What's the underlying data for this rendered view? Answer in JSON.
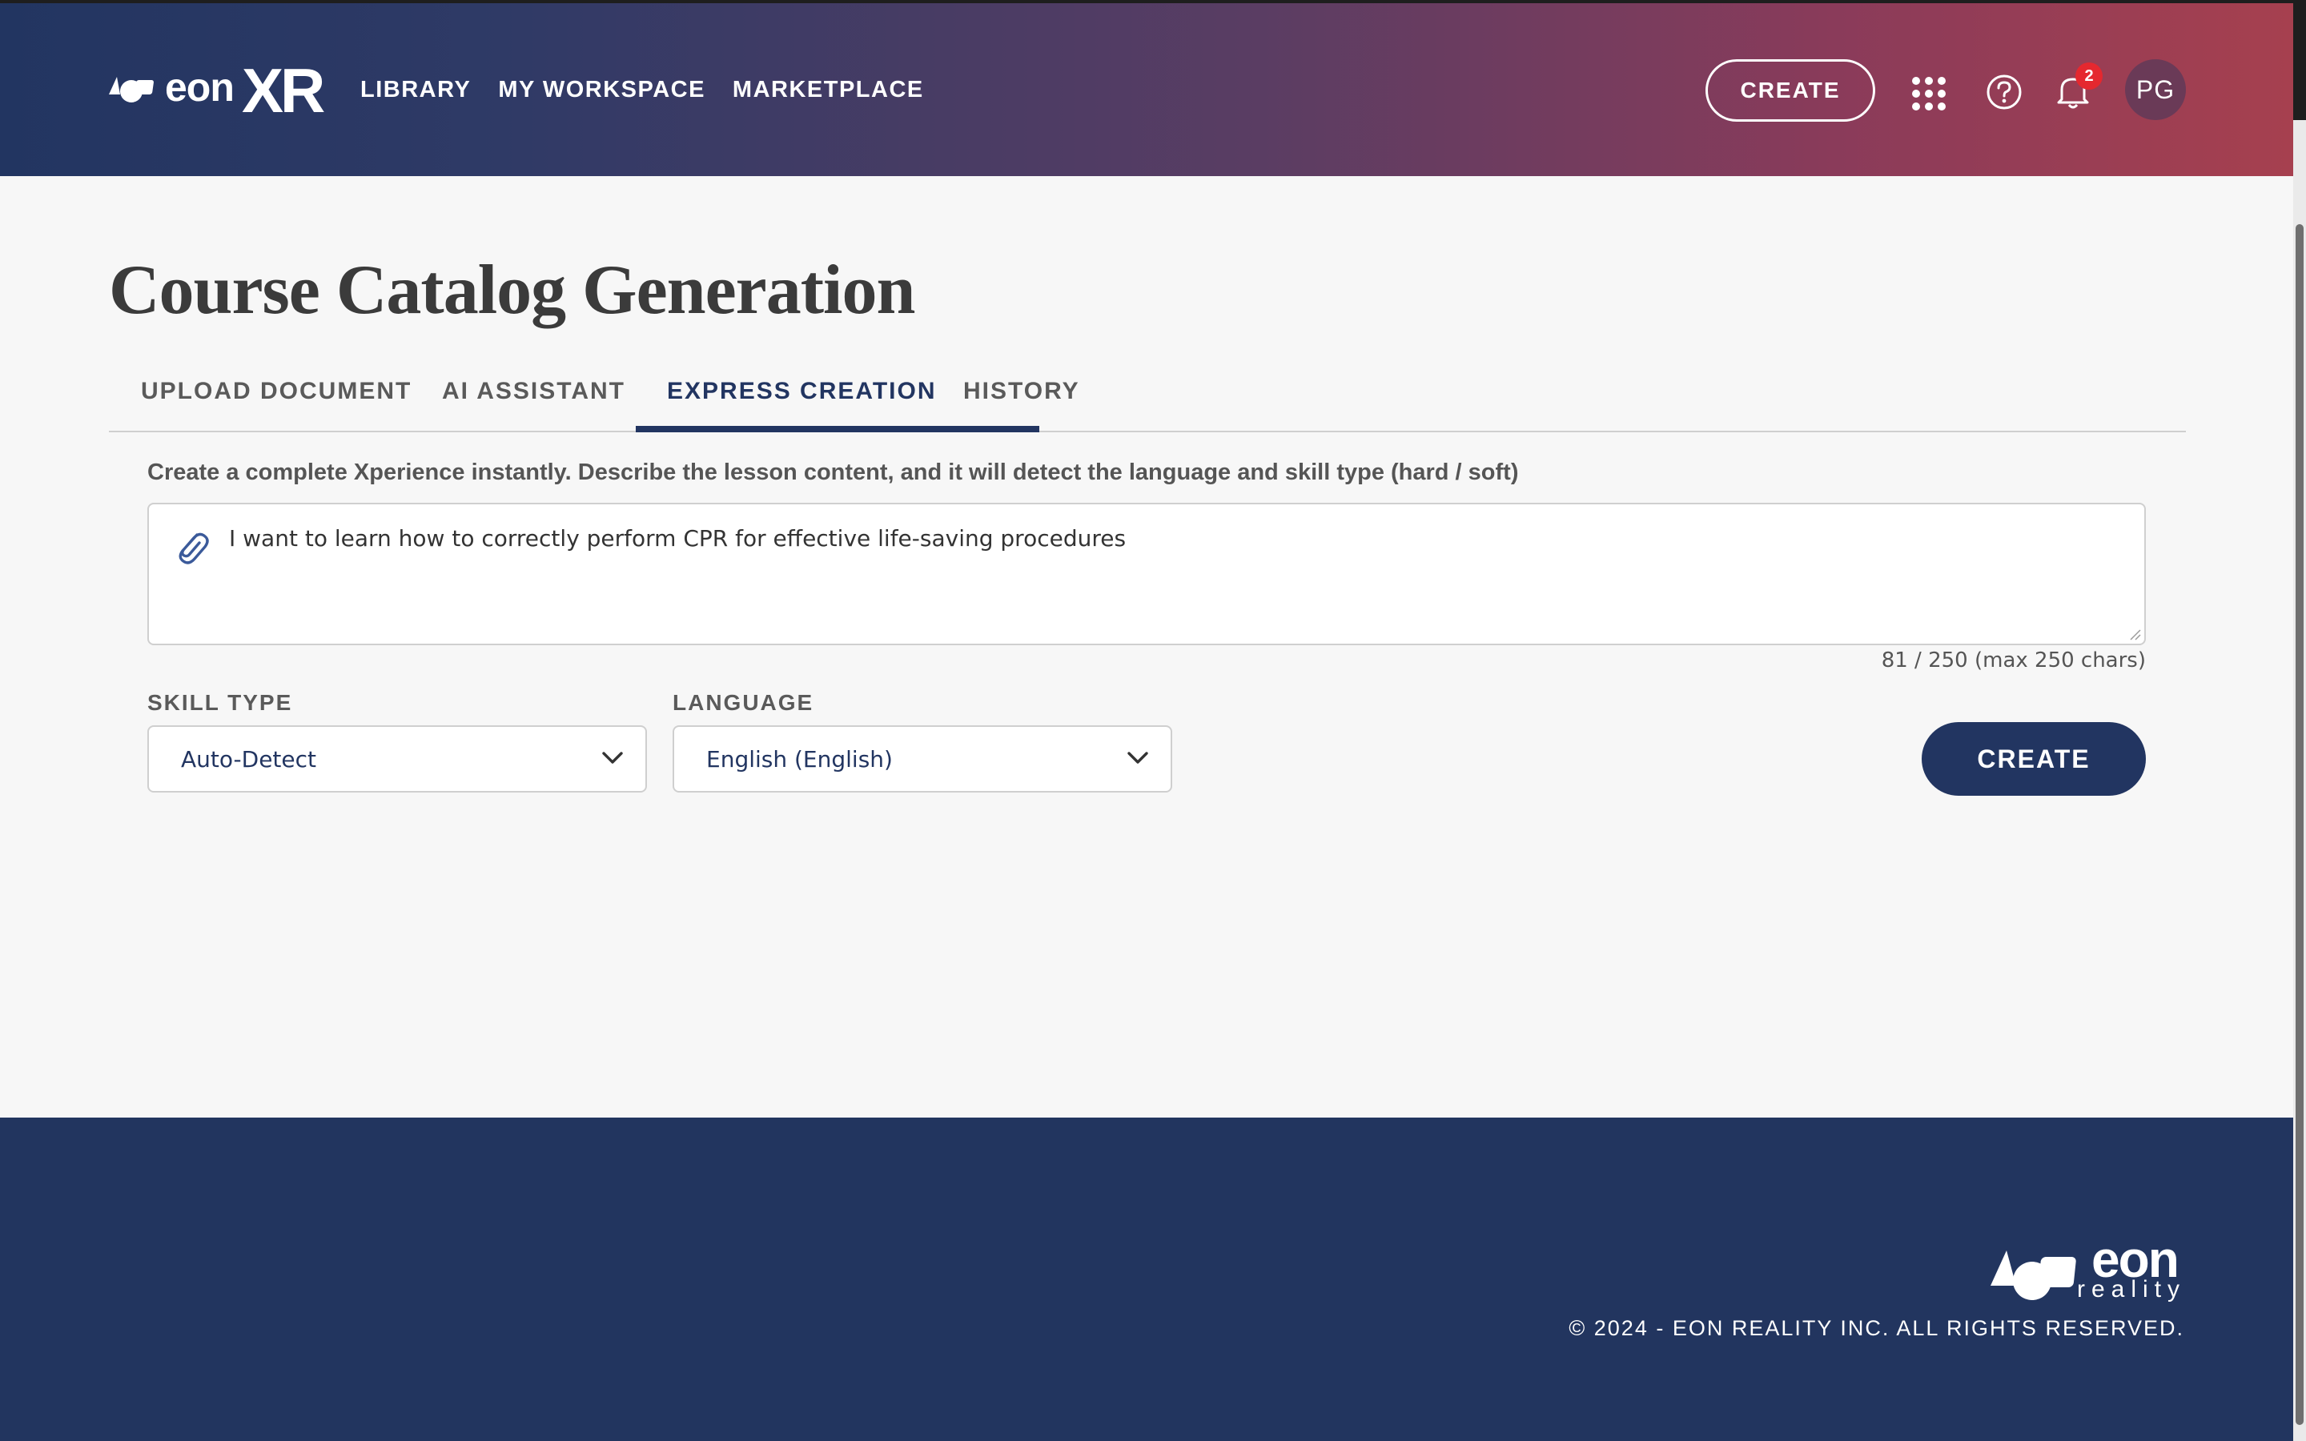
{
  "header": {
    "logo": {
      "word": "eon",
      "xr": "XR",
      "icon": "eon-logo-icon"
    },
    "nav": [
      {
        "label": "LIBRARY"
      },
      {
        "label": "MY WORKSPACE"
      },
      {
        "label": "MARKETPLACE"
      }
    ],
    "create_label": "CREATE",
    "notifications_count": "2",
    "avatar_initials": "PG"
  },
  "main": {
    "title": "Course Catalog Generation",
    "tabs": [
      {
        "label": "UPLOAD DOCUMENT",
        "active": false
      },
      {
        "label": "AI ASSISTANT",
        "active": false
      },
      {
        "label": "EXPRESS CREATION",
        "active": true
      },
      {
        "label": "HISTORY",
        "active": false
      }
    ],
    "description": "Create a complete Xperience instantly. Describe the lesson content, and it will detect the language and skill type (hard / soft)",
    "prompt_value": "I want to learn how to correctly perform CPR for effective life-saving procedures",
    "char_count": "81 / 250 (max 250 chars)",
    "skill_type": {
      "label": "SKILL TYPE",
      "value": "Auto-Detect"
    },
    "language": {
      "label": "LANGUAGE",
      "value": "English (English)"
    },
    "create_label": "CREATE"
  },
  "footer": {
    "logo_word": "eon",
    "logo_sub": "reality",
    "copyright": "© 2024 - EON REALITY INC. ALL RIGHTS RESERVED."
  },
  "colors": {
    "navy": "#223561",
    "header_gradient_start": "#223561",
    "header_gradient_end": "#a6404f",
    "badge": "#e5282f"
  }
}
